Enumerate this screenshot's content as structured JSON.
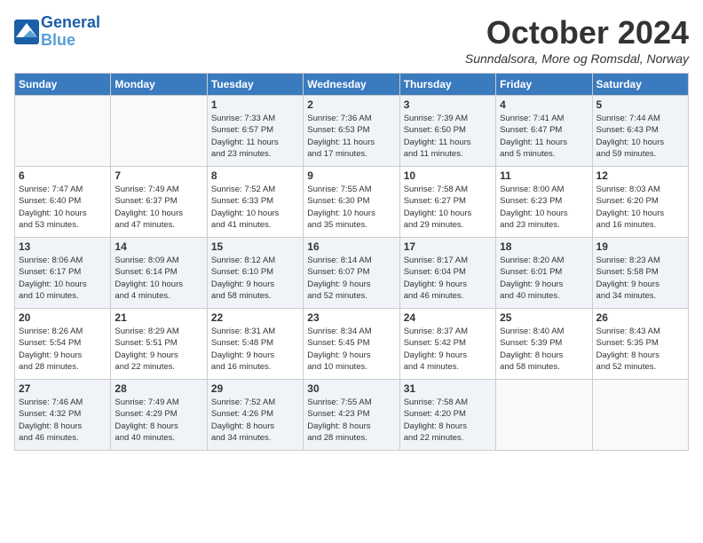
{
  "header": {
    "logo_line1": "General",
    "logo_line2": "Blue",
    "month_title": "October 2024",
    "location": "Sunndalsora, More og Romsdal, Norway"
  },
  "days_of_week": [
    "Sunday",
    "Monday",
    "Tuesday",
    "Wednesday",
    "Thursday",
    "Friday",
    "Saturday"
  ],
  "weeks": [
    [
      {
        "day": "",
        "info": ""
      },
      {
        "day": "",
        "info": ""
      },
      {
        "day": "1",
        "info": "Sunrise: 7:33 AM\nSunset: 6:57 PM\nDaylight: 11 hours\nand 23 minutes."
      },
      {
        "day": "2",
        "info": "Sunrise: 7:36 AM\nSunset: 6:53 PM\nDaylight: 11 hours\nand 17 minutes."
      },
      {
        "day": "3",
        "info": "Sunrise: 7:39 AM\nSunset: 6:50 PM\nDaylight: 11 hours\nand 11 minutes."
      },
      {
        "day": "4",
        "info": "Sunrise: 7:41 AM\nSunset: 6:47 PM\nDaylight: 11 hours\nand 5 minutes."
      },
      {
        "day": "5",
        "info": "Sunrise: 7:44 AM\nSunset: 6:43 PM\nDaylight: 10 hours\nand 59 minutes."
      }
    ],
    [
      {
        "day": "6",
        "info": "Sunrise: 7:47 AM\nSunset: 6:40 PM\nDaylight: 10 hours\nand 53 minutes."
      },
      {
        "day": "7",
        "info": "Sunrise: 7:49 AM\nSunset: 6:37 PM\nDaylight: 10 hours\nand 47 minutes."
      },
      {
        "day": "8",
        "info": "Sunrise: 7:52 AM\nSunset: 6:33 PM\nDaylight: 10 hours\nand 41 minutes."
      },
      {
        "day": "9",
        "info": "Sunrise: 7:55 AM\nSunset: 6:30 PM\nDaylight: 10 hours\nand 35 minutes."
      },
      {
        "day": "10",
        "info": "Sunrise: 7:58 AM\nSunset: 6:27 PM\nDaylight: 10 hours\nand 29 minutes."
      },
      {
        "day": "11",
        "info": "Sunrise: 8:00 AM\nSunset: 6:23 PM\nDaylight: 10 hours\nand 23 minutes."
      },
      {
        "day": "12",
        "info": "Sunrise: 8:03 AM\nSunset: 6:20 PM\nDaylight: 10 hours\nand 16 minutes."
      }
    ],
    [
      {
        "day": "13",
        "info": "Sunrise: 8:06 AM\nSunset: 6:17 PM\nDaylight: 10 hours\nand 10 minutes."
      },
      {
        "day": "14",
        "info": "Sunrise: 8:09 AM\nSunset: 6:14 PM\nDaylight: 10 hours\nand 4 minutes."
      },
      {
        "day": "15",
        "info": "Sunrise: 8:12 AM\nSunset: 6:10 PM\nDaylight: 9 hours\nand 58 minutes."
      },
      {
        "day": "16",
        "info": "Sunrise: 8:14 AM\nSunset: 6:07 PM\nDaylight: 9 hours\nand 52 minutes."
      },
      {
        "day": "17",
        "info": "Sunrise: 8:17 AM\nSunset: 6:04 PM\nDaylight: 9 hours\nand 46 minutes."
      },
      {
        "day": "18",
        "info": "Sunrise: 8:20 AM\nSunset: 6:01 PM\nDaylight: 9 hours\nand 40 minutes."
      },
      {
        "day": "19",
        "info": "Sunrise: 8:23 AM\nSunset: 5:58 PM\nDaylight: 9 hours\nand 34 minutes."
      }
    ],
    [
      {
        "day": "20",
        "info": "Sunrise: 8:26 AM\nSunset: 5:54 PM\nDaylight: 9 hours\nand 28 minutes."
      },
      {
        "day": "21",
        "info": "Sunrise: 8:29 AM\nSunset: 5:51 PM\nDaylight: 9 hours\nand 22 minutes."
      },
      {
        "day": "22",
        "info": "Sunrise: 8:31 AM\nSunset: 5:48 PM\nDaylight: 9 hours\nand 16 minutes."
      },
      {
        "day": "23",
        "info": "Sunrise: 8:34 AM\nSunset: 5:45 PM\nDaylight: 9 hours\nand 10 minutes."
      },
      {
        "day": "24",
        "info": "Sunrise: 8:37 AM\nSunset: 5:42 PM\nDaylight: 9 hours\nand 4 minutes."
      },
      {
        "day": "25",
        "info": "Sunrise: 8:40 AM\nSunset: 5:39 PM\nDaylight: 8 hours\nand 58 minutes."
      },
      {
        "day": "26",
        "info": "Sunrise: 8:43 AM\nSunset: 5:35 PM\nDaylight: 8 hours\nand 52 minutes."
      }
    ],
    [
      {
        "day": "27",
        "info": "Sunrise: 7:46 AM\nSunset: 4:32 PM\nDaylight: 8 hours\nand 46 minutes."
      },
      {
        "day": "28",
        "info": "Sunrise: 7:49 AM\nSunset: 4:29 PM\nDaylight: 8 hours\nand 40 minutes."
      },
      {
        "day": "29",
        "info": "Sunrise: 7:52 AM\nSunset: 4:26 PM\nDaylight: 8 hours\nand 34 minutes."
      },
      {
        "day": "30",
        "info": "Sunrise: 7:55 AM\nSunset: 4:23 PM\nDaylight: 8 hours\nand 28 minutes."
      },
      {
        "day": "31",
        "info": "Sunrise: 7:58 AM\nSunset: 4:20 PM\nDaylight: 8 hours\nand 22 minutes."
      },
      {
        "day": "",
        "info": ""
      },
      {
        "day": "",
        "info": ""
      }
    ]
  ]
}
